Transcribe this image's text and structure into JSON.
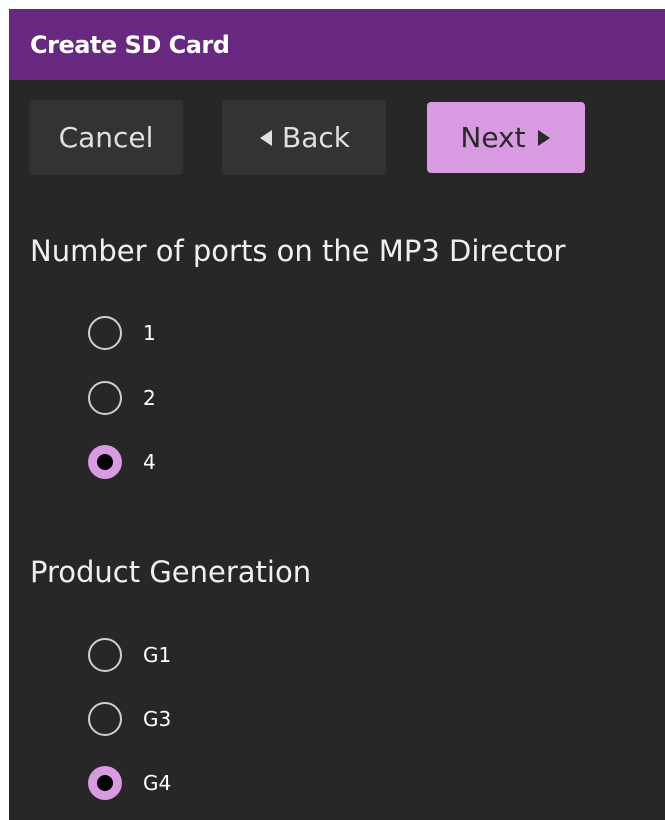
{
  "window": {
    "title": "Create SD Card"
  },
  "toolbar": {
    "cancel_label": "Cancel",
    "back_label": "Back",
    "back_icon": "chevron-left-icon",
    "next_label": "Next",
    "next_icon": "chevron-right-icon"
  },
  "ports_section": {
    "title": "Number of ports on the MP3 Director",
    "options": [
      {
        "label": "1",
        "selected": false
      },
      {
        "label": "2",
        "selected": false
      },
      {
        "label": "4",
        "selected": true
      }
    ]
  },
  "generation_section": {
    "title": "Product Generation",
    "options": [
      {
        "label": "G1",
        "selected": false
      },
      {
        "label": "G3",
        "selected": false
      },
      {
        "label": "G4",
        "selected": true
      }
    ]
  },
  "colors": {
    "titlebar": "#682880",
    "background": "#272727",
    "accent": "#d89ae0",
    "button": "#333333"
  }
}
